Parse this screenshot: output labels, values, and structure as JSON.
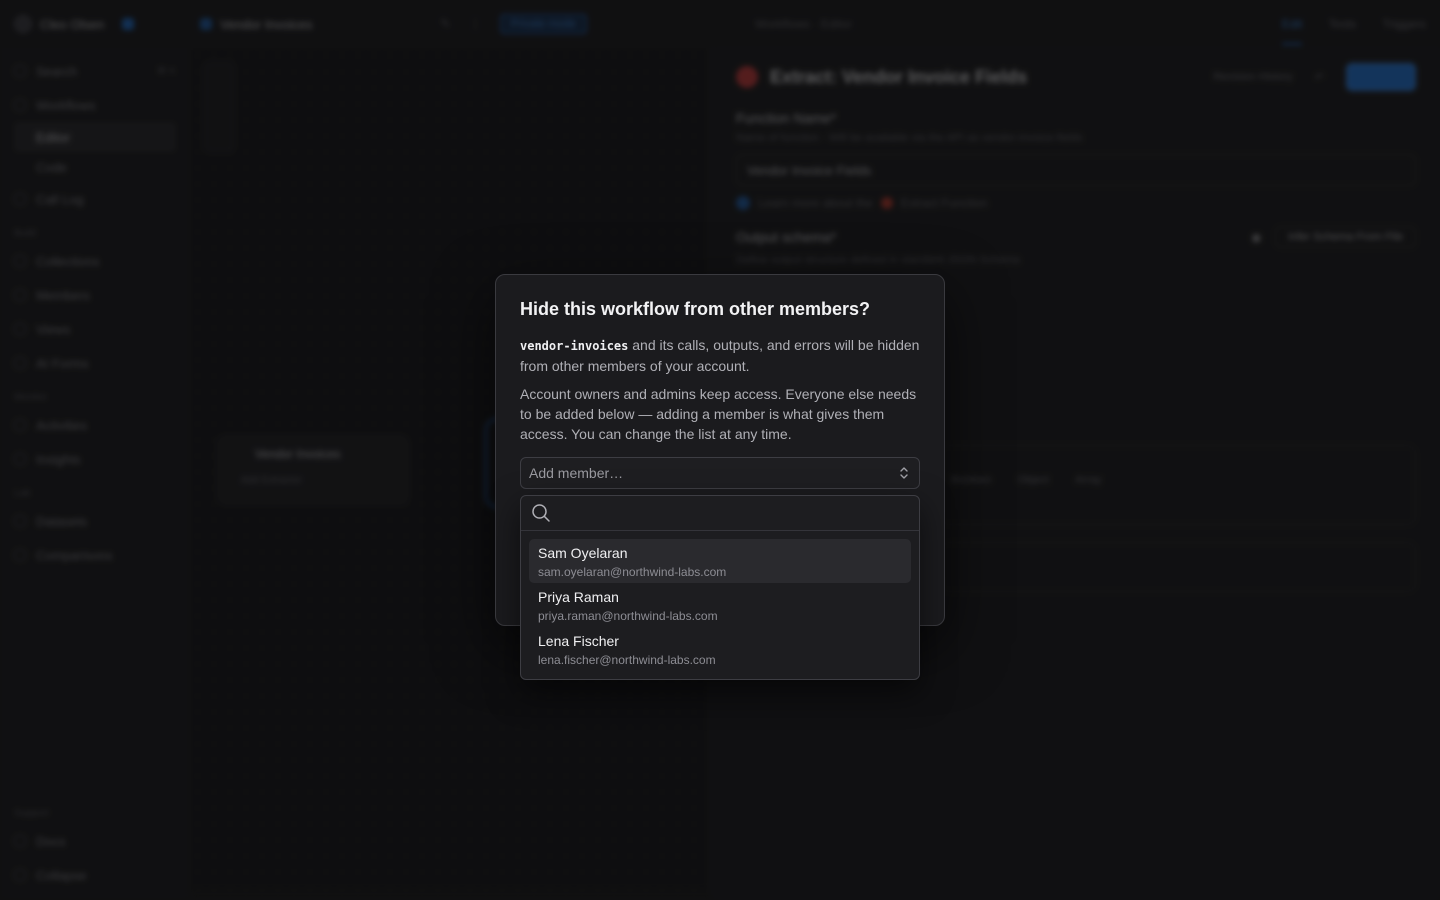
{
  "topbar": {
    "user_name": "Cleo Olsen",
    "workflow_name": "Vendor Invoices",
    "private_label": "Private mode",
    "center_title": "Workflows · Editor",
    "modes": [
      "Edit",
      "Tests",
      "Triggers"
    ]
  },
  "sidebar": {
    "items": [
      {
        "label": "Search",
        "kbd": "⌘ K"
      },
      {
        "label": "Workflows"
      },
      {
        "label": "Editor",
        "sub": true,
        "selected": true
      },
      {
        "label": "Code",
        "sub": true
      },
      {
        "label": "Call Log"
      }
    ],
    "sections": [
      {
        "title": "Build",
        "items": [
          "Collections",
          "Members",
          "Views",
          "AI Forms"
        ]
      },
      {
        "title": "Monitor",
        "items": [
          "Activities",
          "Insights"
        ]
      },
      {
        "title": "Lab",
        "items": [
          "Datasets",
          "Comparisons"
        ]
      }
    ],
    "bottom_section": "Support",
    "bottom_items": [
      "Docs",
      "Collapse"
    ]
  },
  "canvas": {
    "node_title": "Vendor Invoices",
    "node_sub": "Add Extractor"
  },
  "panel": {
    "fn_title": "Extract: Vendor Invoice Fields",
    "revision_history": "Revision History",
    "function_name_label": "Function Name*",
    "function_name_help": "Name of function · Will be available via the API as vendor-invoice-fields",
    "function_name_value": "Vendor Invoice Fields",
    "learn_more": "Learn more about the",
    "extract_function": "Extract Function",
    "output_schema_label": "Output schema*",
    "output_schema_help": "Define output structure defined in standard JSON Schema",
    "infer_schema": "Infer Schema From File",
    "types": [
      "Boolean",
      "Object",
      "Array"
    ]
  },
  "modal": {
    "title": "Hide this workflow from other members?",
    "workflow_slug": "vendor-invoices",
    "para1_rest": " and its calls, outputs, and errors will be hidden from other members of your account.",
    "para2": "Account owners and admins keep access. Everyone else needs to be added below — adding a member is what gives them access. You can change the list at any time.",
    "select_placeholder": "Add member…"
  },
  "dropdown": {
    "search_value": "",
    "members": [
      {
        "name": "Sam Oyelaran",
        "email": "sam.oyelaran@northwind-labs.com"
      },
      {
        "name": "Priya Raman",
        "email": "priya.raman@northwind-labs.com"
      },
      {
        "name": "Lena Fischer",
        "email": "lena.fischer@northwind-labs.com"
      }
    ]
  },
  "colors": {
    "accent": "#1f7ae6",
    "modal_bg": "#1b1b1e",
    "danger_dot": "#d33a3a"
  }
}
